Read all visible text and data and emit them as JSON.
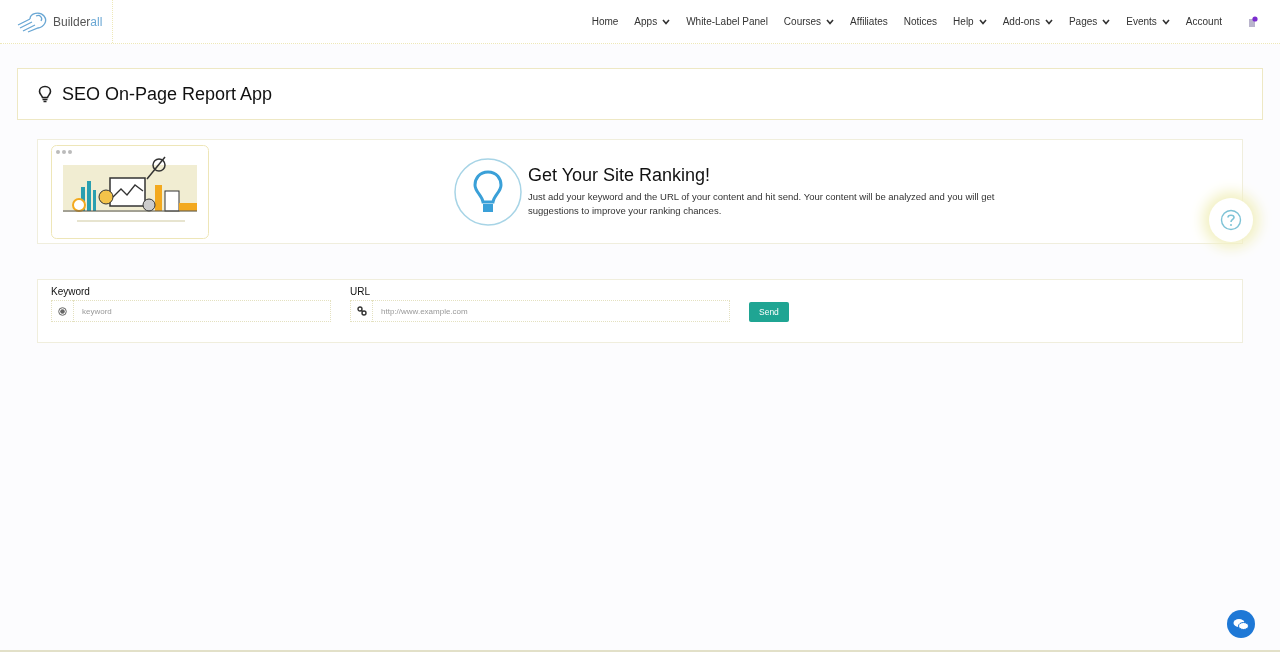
{
  "logo": {
    "text": "Builder",
    "accent": "all"
  },
  "nav": [
    {
      "label": "Home",
      "dropdown": false
    },
    {
      "label": "Apps",
      "dropdown": true
    },
    {
      "label": "White-Label Panel",
      "dropdown": false
    },
    {
      "label": "Courses",
      "dropdown": true
    },
    {
      "label": "Affiliates",
      "dropdown": false
    },
    {
      "label": "Notices",
      "dropdown": false
    },
    {
      "label": "Help",
      "dropdown": true
    },
    {
      "label": "Add-ons",
      "dropdown": true
    },
    {
      "label": "Pages",
      "dropdown": true
    },
    {
      "label": "Events",
      "dropdown": true
    },
    {
      "label": "Account",
      "dropdown": false
    }
  ],
  "page_title": "SEO On-Page Report App",
  "hero": {
    "heading": "Get Your Site Ranking!",
    "text": "Just add your keyword and the URL of your content and hit send. Your content will be analyzed and you will get suggestions to improve your ranking chances."
  },
  "form": {
    "keyword": {
      "label": "Keyword",
      "placeholder": "keyword"
    },
    "url": {
      "label": "URL",
      "placeholder": "http://www.example.com"
    },
    "button": "Send"
  }
}
